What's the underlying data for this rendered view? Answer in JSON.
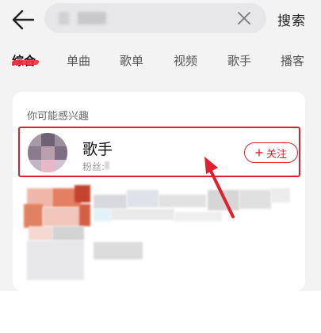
{
  "header": {
    "search_button": "搜索"
  },
  "tabs": [
    {
      "label": "综合",
      "active": true
    },
    {
      "label": "单曲",
      "active": false
    },
    {
      "label": "歌单",
      "active": false
    },
    {
      "label": "视频",
      "active": false
    },
    {
      "label": "歌手",
      "active": false
    },
    {
      "label": "播客",
      "active": false
    }
  ],
  "card": {
    "title": "你可能感兴趣",
    "artist": {
      "name": "歌手",
      "fans_label": "粉丝:",
      "follow_label": "关注"
    }
  },
  "colors": {
    "accent": "#e0202e",
    "background": "#f3f3f4"
  },
  "icons": [
    "back-arrow-icon",
    "clear-icon",
    "plus-icon"
  ]
}
